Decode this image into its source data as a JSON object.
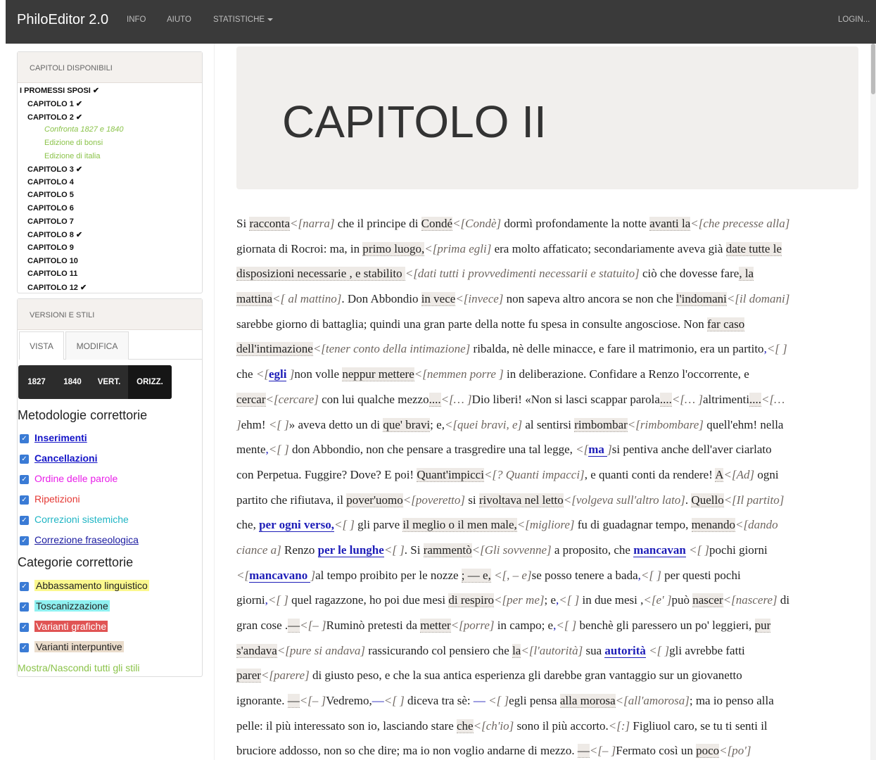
{
  "navbar": {
    "brand": "PhiloEditor 2.0",
    "info": "INFO",
    "aiuto": "AIUTO",
    "statistiche": "STATISTICHE",
    "login": "LOGIN..."
  },
  "chapters_panel": {
    "title": "CAPITOLI DISPONIBILI",
    "book": "I PROMESSI SPOSI",
    "items": [
      {
        "label": "CAPITOLO 1",
        "checked": true
      },
      {
        "label": "CAPITOLO 2",
        "checked": true
      },
      {
        "label": "CAPITOLO 3",
        "checked": true
      },
      {
        "label": "CAPITOLO 4",
        "checked": false
      },
      {
        "label": "CAPITOLO 5",
        "checked": false
      },
      {
        "label": "CAPITOLO 6",
        "checked": false
      },
      {
        "label": "CAPITOLO 7",
        "checked": false
      },
      {
        "label": "CAPITOLO 8",
        "checked": true
      },
      {
        "label": "CAPITOLO 9",
        "checked": false
      },
      {
        "label": "CAPITOLO 10",
        "checked": false
      },
      {
        "label": "CAPITOLO 11",
        "checked": false
      },
      {
        "label": "CAPITOLO 12",
        "checked": true
      }
    ],
    "subitems": [
      "Confronta 1827 e 1840",
      "Edizione di bonsi",
      "Edizione di italia"
    ],
    "check_glyph": "✔"
  },
  "versions_panel": {
    "title": "VERSIONI E STILI",
    "tab_vista": "VISTA",
    "tab_modifica": "MODIFICA",
    "buttons": [
      "1827",
      "1840",
      "VERT.",
      "ORIZZ."
    ],
    "metodologie_title": "Metodologie correttorie",
    "metodologie": [
      {
        "label": "Inserimenti",
        "color": "#1515c8"
      },
      {
        "label": "Cancellazioni",
        "color": "#1515c8"
      },
      {
        "label": "Ordine delle parole",
        "color": "#e81ee8"
      },
      {
        "label": "Ripetizioni",
        "color": "#e53935"
      },
      {
        "label": "Correzioni sistemiche",
        "color": "#1fb5c4"
      },
      {
        "label": "Correzione fraseologica",
        "color": "#1a1aa0"
      }
    ],
    "categorie_title": "Categorie correttorie",
    "categorie": [
      {
        "label": "Abbassamento linguistico",
        "bg": "#fbf88e"
      },
      {
        "label": "Toscanizzazione",
        "bg": "#8ff1f1"
      },
      {
        "label": "Varianti grafiche",
        "bg": "#e05454"
      },
      {
        "label": "Varianti interpuntive",
        "bg": "#eadccb"
      }
    ],
    "toggle_all": "Mostra/Nascondi tutti gli stili"
  },
  "main": {
    "chapter_title": "CAPITOLO II"
  }
}
